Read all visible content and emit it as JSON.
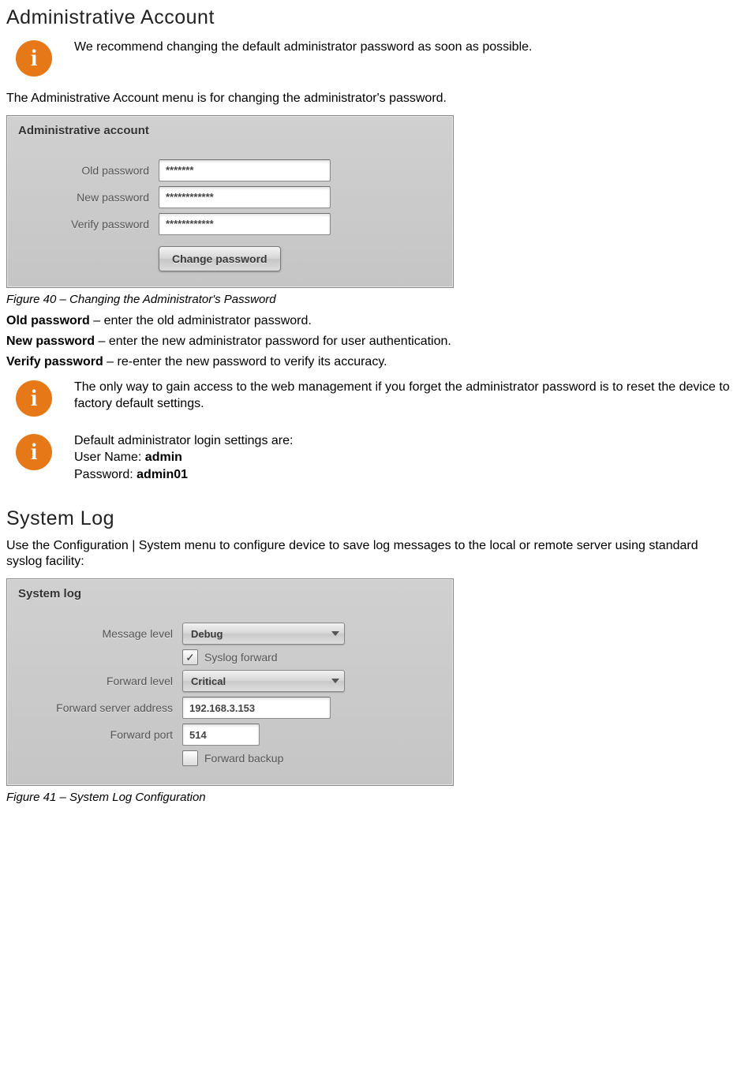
{
  "section1": {
    "title": "Administrative Account",
    "info1": "We recommend changing the default administrator password as soon as possible.",
    "intro": "The Administrative Account menu is for changing the administrator's password.",
    "figure_caption": "Figure 40 – Changing the Administrator's Password",
    "old_label_bold": "Old password",
    "old_label_rest": " – enter the old administrator password.",
    "new_label_bold": "New password",
    "new_label_rest": " – enter the new administrator password for user authentication.",
    "ver_label_bold": "Verify password",
    "ver_label_rest": " – re-enter the new password to verify its accuracy.",
    "info2": "The only way to gain access to the web management if you forget the administrator password is to reset the device to factory default settings.",
    "info3_line1": "Default administrator login settings are:",
    "info3_user_lbl": "User Name: ",
    "info3_user_val": "admin",
    "info3_pass_lbl": "Password: ",
    "info3_pass_val": "admin01"
  },
  "admin_panel": {
    "title": "Administrative account",
    "old_label": "Old password",
    "old_value": "*******",
    "new_label": "New password",
    "new_value": "************",
    "ver_label": "Verify password",
    "ver_value": "************",
    "button": "Change password"
  },
  "section2": {
    "title": "System Log",
    "intro": "Use the Configuration | System menu to configure device to save log messages to the local or remote server using standard syslog facility:",
    "figure_caption": "Figure 41 – System Log Configuration"
  },
  "syslog_panel": {
    "title": "System log",
    "msg_label": "Message level",
    "msg_value": "Debug",
    "syslog_forward_label": "Syslog forward",
    "syslog_forward_checked": true,
    "fwd_level_label": "Forward level",
    "fwd_level_value": "Critical",
    "fwd_addr_label": "Forward server address",
    "fwd_addr_value": "192.168.3.153",
    "fwd_port_label": "Forward port",
    "fwd_port_value": "514",
    "fwd_backup_label": "Forward backup",
    "fwd_backup_checked": false
  }
}
